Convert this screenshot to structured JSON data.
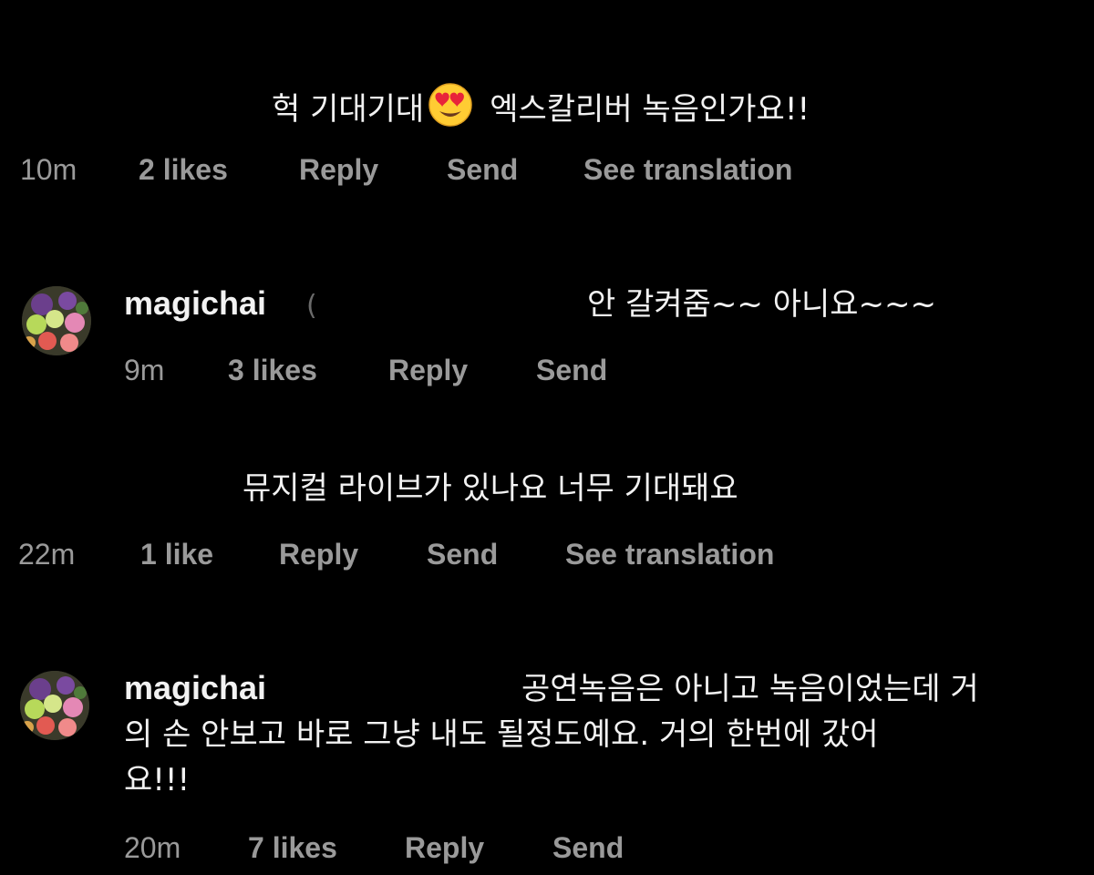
{
  "comments": [
    {
      "text_before_emoji": "헉 기대기대",
      "emoji": "smiling-face-with-heart-eyes",
      "text_after_emoji": "엑스칼리버 녹음인가요!!",
      "time": "10m",
      "likes": "2 likes",
      "reply": "Reply",
      "send": "Send",
      "translate": "See translation"
    },
    {
      "username": "magichai",
      "avatar_icon": "flower-avatar",
      "text": "안 갈켜줌~~ 아니요~~~",
      "time": "9m",
      "likes": "3 likes",
      "reply": "Reply",
      "send": "Send"
    },
    {
      "text": "뮤지컬 라이브가 있나요 너무 기대돼요",
      "time": "22m",
      "likes": "1 like",
      "reply": "Reply",
      "send": "Send",
      "translate": "See translation"
    },
    {
      "username": "magichai",
      "avatar_icon": "flower-avatar",
      "line1": "공연녹음은 아니고 녹음이었는데 거",
      "line2": "의 손 안보고 바로 그냥 내도 될정도예요. 거의 한번에 갔어",
      "line3": "요!!!",
      "time": "20m",
      "likes": "7 likes",
      "reply": "Reply",
      "send": "Send"
    }
  ],
  "colors": {
    "background": "#000000",
    "text": "#f2f2f2",
    "meta": "#9a9a9a"
  }
}
